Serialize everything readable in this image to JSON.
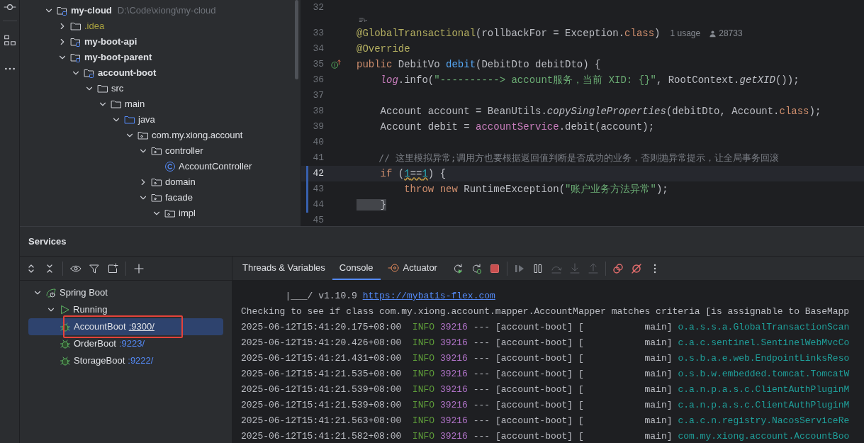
{
  "project_tree": [
    {
      "label": "my-cloud",
      "path": "D:\\Code\\xiong\\my-cloud",
      "kind": "module",
      "expanded": true,
      "ignored": false,
      "children": [
        {
          "label": ".idea",
          "kind": "folder",
          "expanded": false,
          "ignored": true
        },
        {
          "label": "my-boot-api",
          "kind": "module",
          "expanded": false,
          "ignored": false
        },
        {
          "label": "my-boot-parent",
          "kind": "module",
          "expanded": true,
          "ignored": false,
          "children": [
            {
              "label": "account-boot",
              "kind": "module",
              "expanded": true,
              "ignored": false,
              "children": [
                {
                  "label": "src",
                  "kind": "folder",
                  "expanded": true,
                  "ignored": false,
                  "children": [
                    {
                      "label": "main",
                      "kind": "folder",
                      "expanded": true,
                      "ignored": false,
                      "children": [
                        {
                          "label": "java",
                          "kind": "source",
                          "expanded": true,
                          "ignored": false,
                          "children": [
                            {
                              "label": "com.my.xiong.account",
                              "kind": "package",
                              "expanded": true,
                              "ignored": false,
                              "children": [
                                {
                                  "label": "controller",
                                  "kind": "package",
                                  "expanded": true,
                                  "ignored": false,
                                  "children": [
                                    {
                                      "label": "AccountController",
                                      "kind": "class",
                                      "ignored": false
                                    }
                                  ]
                                },
                                {
                                  "label": "domain",
                                  "kind": "package",
                                  "expanded": false,
                                  "ignored": false
                                },
                                {
                                  "label": "facade",
                                  "kind": "package",
                                  "expanded": true,
                                  "ignored": false,
                                  "children": [
                                    {
                                      "label": "impl",
                                      "kind": "package",
                                      "expanded": true,
                                      "ignored": false
                                    }
                                  ]
                                }
                              ]
                            }
                          ]
                        }
                      ]
                    }
                  ]
                }
              ]
            }
          ]
        }
      ]
    }
  ],
  "editor": {
    "lines": [
      {
        "kind": "code",
        "number": "32",
        "current": false,
        "changed": false,
        "implements": false
      },
      {
        "kind": "author_inlay"
      },
      {
        "kind": "code",
        "number": "33",
        "current": false,
        "changed": false,
        "implements": false,
        "tokens": [
          {
            "text": "@GlobalTransactional",
            "kind": "annotation"
          },
          {
            "text": "(rollbackFor = Exception.",
            "kind": "plain"
          },
          {
            "text": "class",
            "kind": "keyword"
          },
          {
            "text": ")",
            "kind": "plain"
          }
        ],
        "usages": "1 usage",
        "author": "28733"
      },
      {
        "kind": "code",
        "number": "34",
        "current": false,
        "changed": false,
        "implements": false,
        "tokens": [
          {
            "text": "@Override",
            "kind": "annotation"
          }
        ]
      },
      {
        "kind": "code",
        "number": "35",
        "current": false,
        "changed": false,
        "implements": true,
        "tokens": [
          {
            "text": "public ",
            "kind": "keyword"
          },
          {
            "text": "DebitVo ",
            "kind": "plain"
          },
          {
            "text": "debit",
            "kind": "function"
          },
          {
            "text": "(DebitDto debitDto) {",
            "kind": "plain"
          }
        ]
      },
      {
        "kind": "code",
        "number": "36",
        "current": false,
        "changed": false,
        "implements": false,
        "tokens": [
          {
            "text": "    log",
            "kind": "static_field"
          },
          {
            "text": ".info(",
            "kind": "plain"
          },
          {
            "text": "\"----------> account服务，当前 XID: {}\"",
            "kind": "string"
          },
          {
            "text": ", RootContext.",
            "kind": "plain"
          },
          {
            "text": "getXID",
            "kind": "static_method"
          },
          {
            "text": "());",
            "kind": "plain"
          }
        ]
      },
      {
        "kind": "code",
        "number": "37",
        "current": false,
        "changed": false,
        "implements": false
      },
      {
        "kind": "code",
        "number": "38",
        "current": false,
        "changed": false,
        "implements": false,
        "tokens": [
          {
            "text": "    Account account = BeanUtils.",
            "kind": "plain"
          },
          {
            "text": "copySingleProperties",
            "kind": "static_method"
          },
          {
            "text": "(debitDto, Account.",
            "kind": "plain"
          },
          {
            "text": "class",
            "kind": "keyword"
          },
          {
            "text": ");",
            "kind": "plain"
          }
        ]
      },
      {
        "kind": "code",
        "number": "39",
        "current": false,
        "changed": false,
        "implements": false,
        "tokens": [
          {
            "text": "    Account debit = ",
            "kind": "plain"
          },
          {
            "text": "accountService",
            "kind": "field"
          },
          {
            "text": ".debit(account);",
            "kind": "plain"
          }
        ]
      },
      {
        "kind": "code",
        "number": "40",
        "current": false,
        "changed": false,
        "implements": false
      },
      {
        "kind": "code",
        "number": "41",
        "current": false,
        "changed": false,
        "implements": false,
        "tokens": [
          {
            "text": "    // 这里模拟异常;调用方也要根据返回值判断是否成功的业务，否则抛异常提示，让全局事务回滚",
            "kind": "comment"
          }
        ]
      },
      {
        "kind": "code",
        "number": "42",
        "current": true,
        "changed": true,
        "implements": false,
        "tokens": [
          {
            "text": "    if ",
            "kind": "keyword"
          },
          {
            "text": "(",
            "kind": "plain"
          },
          {
            "text": "1",
            "kind": "number_warning"
          },
          {
            "text": "==",
            "kind": "plain_warning"
          },
          {
            "text": "1",
            "kind": "number_warning"
          },
          {
            "text": ") {",
            "kind": "plain"
          }
        ]
      },
      {
        "kind": "code",
        "number": "43",
        "current": false,
        "changed": true,
        "implements": false,
        "tokens": [
          {
            "text": "        throw ",
            "kind": "keyword"
          },
          {
            "text": "new ",
            "kind": "keyword"
          },
          {
            "text": "RuntimeException(",
            "kind": "plain"
          },
          {
            "text": "\"账户业务方法异常\"",
            "kind": "string"
          },
          {
            "text": ");",
            "kind": "plain"
          }
        ]
      },
      {
        "kind": "code",
        "number": "44",
        "current": false,
        "changed": true,
        "implements": false,
        "tokens": [
          {
            "text": "    }",
            "kind": "brace_match"
          }
        ]
      },
      {
        "kind": "code",
        "number": "45",
        "current": false,
        "changed": false,
        "implements": false
      }
    ]
  },
  "services": {
    "title": "Services",
    "tree": [
      {
        "label": "Spring Boot",
        "kind": "spring",
        "expanded": true,
        "children": [
          {
            "label": "Running",
            "kind": "running",
            "expanded": true,
            "children": [
              {
                "label": "AccountBoot",
                "port": ":9300/",
                "kind": "app",
                "selected": true,
                "highlighted": true
              },
              {
                "label": "OrderBoot",
                "port": ":9223/",
                "kind": "app",
                "selected": false,
                "highlighted": false
              },
              {
                "label": "StorageBoot",
                "port": ":9222/",
                "kind": "app",
                "selected": false,
                "highlighted": false
              }
            ]
          }
        ]
      }
    ],
    "tabs": [
      {
        "label": "Threads & Variables",
        "kind": "plain",
        "selected": false
      },
      {
        "label": "Console",
        "kind": "plain",
        "selected": true
      },
      {
        "label": "Actuator",
        "kind": "actuator",
        "selected": false
      }
    ],
    "console": [
      {
        "kind": "banner",
        "text": "        |___/ v1.10.9 ",
        "link": "https://mybatis-flex.com"
      },
      {
        "kind": "plain",
        "text": "Checking to see if class com.my.xiong.account.mapper.AccountMapper matches criteria [is assignable to BaseMapp"
      },
      {
        "kind": "log",
        "time": "2025-06-12T15:41:20.175+08:00",
        "level": "INFO",
        "pid": "39216",
        "thread": "--- [account-boot] [           main]",
        "logger": "o.a.s.s.a.GlobalTransactionScan"
      },
      {
        "kind": "log",
        "time": "2025-06-12T15:41:20.426+08:00",
        "level": "INFO",
        "pid": "39216",
        "thread": "--- [account-boot] [           main]",
        "logger": "c.a.c.sentinel.SentinelWebMvcCo"
      },
      {
        "kind": "log",
        "time": "2025-06-12T15:41:21.431+08:00",
        "level": "INFO",
        "pid": "39216",
        "thread": "--- [account-boot] [           main]",
        "logger": "o.s.b.a.e.web.EndpointLinksReso"
      },
      {
        "kind": "log",
        "time": "2025-06-12T15:41:21.535+08:00",
        "level": "INFO",
        "pid": "39216",
        "thread": "--- [account-boot] [           main]",
        "logger": "o.s.b.w.embedded.tomcat.TomcatW"
      },
      {
        "kind": "log",
        "time": "2025-06-12T15:41:21.539+08:00",
        "level": "INFO",
        "pid": "39216",
        "thread": "--- [account-boot] [           main]",
        "logger": "c.a.n.p.a.s.c.ClientAuthPluginM"
      },
      {
        "kind": "log",
        "time": "2025-06-12T15:41:21.539+08:00",
        "level": "INFO",
        "pid": "39216",
        "thread": "--- [account-boot] [           main]",
        "logger": "c.a.n.p.a.s.c.ClientAuthPluginM"
      },
      {
        "kind": "log",
        "time": "2025-06-12T15:41:21.563+08:00",
        "level": "INFO",
        "pid": "39216",
        "thread": "--- [account-boot] [           main]",
        "logger": "c.a.c.n.registry.NacosServiceRe"
      },
      {
        "kind": "log",
        "time": "2025-06-12T15:41:21.582+08:00",
        "level": "INFO",
        "pid": "39216",
        "thread": "--- [account-boot] [           main]",
        "logger": "com.my.xiong.account.AccountBoo"
      }
    ]
  }
}
